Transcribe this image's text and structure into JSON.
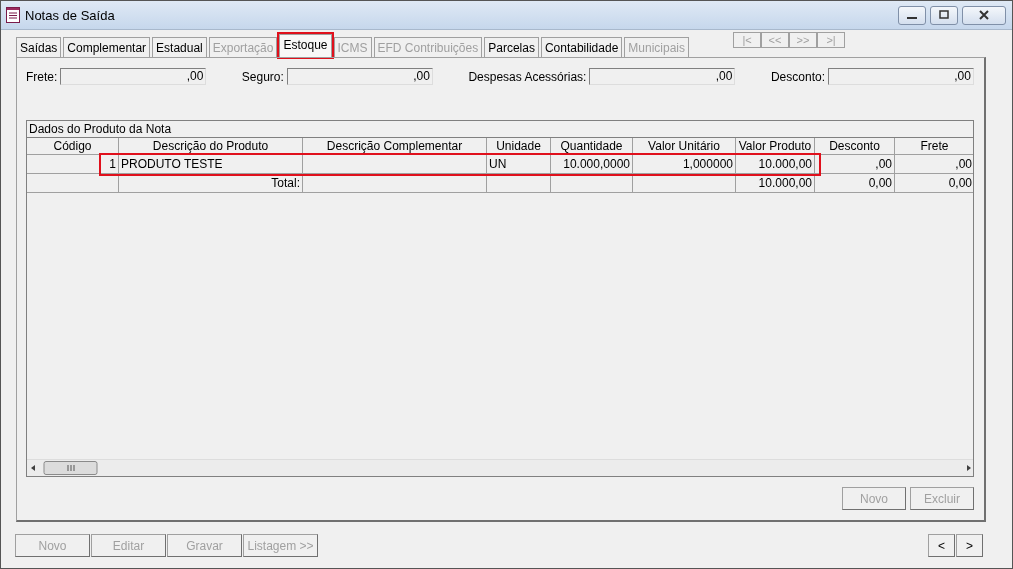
{
  "window": {
    "title": "Notas de Saída"
  },
  "tabs": [
    {
      "label": "Saídas",
      "selected": false,
      "disabled": false,
      "highlighted": false
    },
    {
      "label": "Complementar",
      "selected": false,
      "disabled": false,
      "highlighted": false
    },
    {
      "label": "Estadual",
      "selected": false,
      "disabled": false,
      "highlighted": false
    },
    {
      "label": "Exportação",
      "selected": false,
      "disabled": true,
      "highlighted": false
    },
    {
      "label": "Estoque",
      "selected": true,
      "disabled": false,
      "highlighted": true
    },
    {
      "label": "ICMS",
      "selected": false,
      "disabled": true,
      "highlighted": false
    },
    {
      "label": "EFD Contribuições",
      "selected": false,
      "disabled": true,
      "highlighted": false
    },
    {
      "label": "Parcelas",
      "selected": false,
      "disabled": false,
      "highlighted": false
    },
    {
      "label": "Contabilidade",
      "selected": false,
      "disabled": false,
      "highlighted": false
    },
    {
      "label": "Municipais",
      "selected": false,
      "disabled": true,
      "highlighted": false
    }
  ],
  "record_nav": [
    {
      "label": "|<",
      "disabled": true
    },
    {
      "label": "<<",
      "disabled": true
    },
    {
      "label": ">>",
      "disabled": true
    },
    {
      "label": ">|",
      "disabled": true
    }
  ],
  "totals": [
    {
      "label": "Frete:",
      "value": ",00"
    },
    {
      "label": "Seguro:",
      "value": ",00"
    },
    {
      "label": "Despesas Acessórias:",
      "value": ",00"
    },
    {
      "label": "Desconto:",
      "value": ",00"
    }
  ],
  "grid": {
    "caption": "Dados do Produto da Nota",
    "columns": [
      "Código",
      "Descrição do Produto",
      "Descrição Complementar",
      "Unidade",
      "Quantidade",
      "Valor Unitário",
      "Valor Produto",
      "Desconto",
      "Frete"
    ],
    "rows": [
      {
        "highlighted": true,
        "cells": [
          "1",
          "PRODUTO TESTE",
          null,
          "UN",
          "10.000,0000",
          "1,000000",
          "10.000,00",
          ",00",
          ",00"
        ]
      },
      {
        "highlighted": false,
        "cells": [
          null,
          "Total:",
          null,
          null,
          null,
          null,
          "10.000,00",
          "0,00",
          "0,00"
        ]
      }
    ]
  },
  "panel_buttons": [
    {
      "label": "Novo",
      "disabled": true
    },
    {
      "label": "Excluir",
      "disabled": true
    }
  ],
  "bottom_buttons": [
    {
      "label": "Novo",
      "disabled": true
    },
    {
      "label": "Editar",
      "disabled": true
    },
    {
      "label": "Gravar",
      "disabled": true
    },
    {
      "label": "Listagem >>",
      "disabled": true
    }
  ],
  "page_nav": [
    {
      "label": "<",
      "disabled": false
    },
    {
      "label": ">",
      "disabled": false
    }
  ]
}
